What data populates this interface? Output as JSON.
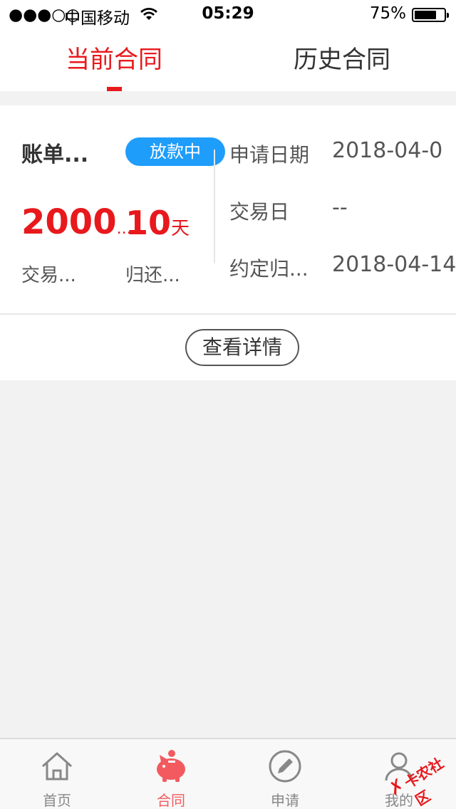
{
  "status_bar": {
    "signal": "●●●○○",
    "carrier": "中国移动",
    "time": "05:29",
    "battery_percent": "75%",
    "battery_level": 0.75
  },
  "tabs": [
    {
      "label": "当前合同",
      "active": true
    },
    {
      "label": "历史合同",
      "active": false
    }
  ],
  "contract": {
    "title": "账单...",
    "status": "放款中",
    "amount": "2000",
    "amount_ellipsis": "...",
    "amount_label": "交易...",
    "days": "10",
    "days_unit": "天",
    "days_label": "归还...",
    "info": [
      {
        "label": "申请日期",
        "value": "2018-04-0"
      },
      {
        "label": "交易日",
        "value": "--"
      },
      {
        "label": "约定归...",
        "value": "2018-04-14"
      }
    ],
    "detail_button": "查看详情"
  },
  "bottom_nav": [
    {
      "label": "首页",
      "icon": "home-icon",
      "active": false
    },
    {
      "label": "合同",
      "icon": "piggy-bank-icon",
      "active": true
    },
    {
      "label": "申请",
      "icon": "pencil-icon",
      "active": false
    },
    {
      "label": "我的",
      "icon": "user-icon",
      "active": false
    }
  ],
  "watermark": "卡农社区",
  "colors": {
    "accent": "#e8191d",
    "badge": "#1e9dfb",
    "nav_active": "#f25a5f"
  }
}
